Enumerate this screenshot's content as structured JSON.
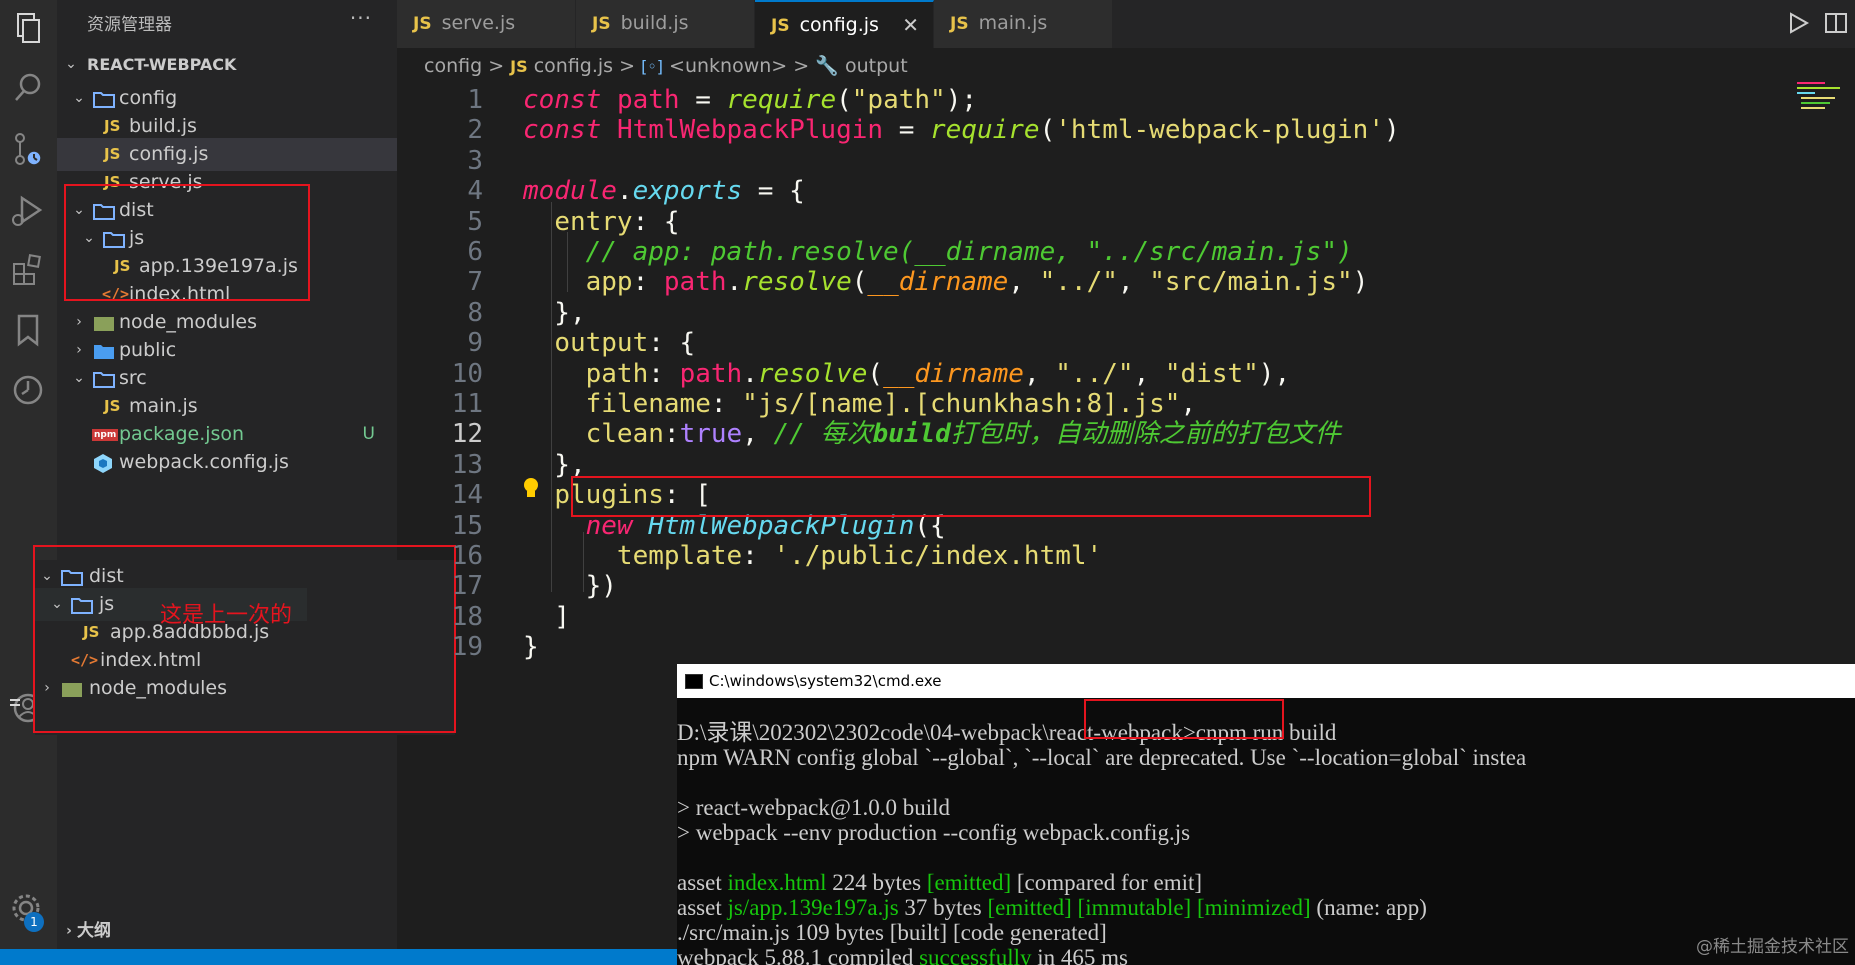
{
  "sidebar": {
    "title": "资源管理器",
    "more": "···",
    "root": "REACT-WEBPACK",
    "tree": [
      {
        "label": "config",
        "type": "folder",
        "open": true
      },
      {
        "label": "build.js",
        "type": "js"
      },
      {
        "label": "config.js",
        "type": "js",
        "selected": true
      },
      {
        "label": "serve.js",
        "type": "js"
      },
      {
        "label": "dist",
        "type": "folder",
        "open": true
      },
      {
        "label": "js",
        "type": "folder",
        "open": true
      },
      {
        "label": "app.139e197a.js",
        "type": "js"
      },
      {
        "label": "index.html",
        "type": "html"
      },
      {
        "label": "node_modules",
        "type": "folder-special",
        "open": false
      },
      {
        "label": "public",
        "type": "folder-blue",
        "open": false
      },
      {
        "label": "src",
        "type": "folder",
        "open": true
      },
      {
        "label": "main.js",
        "type": "js"
      },
      {
        "label": "package.json",
        "type": "npm",
        "git": "U"
      },
      {
        "label": "webpack.config.js",
        "type": "webpack"
      }
    ],
    "outline": "大纲",
    "npm_badge": "npm",
    "js_badge": "JS",
    "html_badge": "</>"
  },
  "previous_panel": {
    "annotation": "这是上一次的",
    "tree": [
      {
        "label": "dist"
      },
      {
        "label": "js"
      },
      {
        "label": "app.8addbbbd.js"
      },
      {
        "label": "index.html"
      },
      {
        "label": "node_modules"
      }
    ]
  },
  "tabs": [
    {
      "label": "serve.js",
      "icon": "JS"
    },
    {
      "label": "build.js",
      "icon": "JS"
    },
    {
      "label": "config.js",
      "icon": "JS",
      "active": true,
      "close": "✕"
    },
    {
      "label": "main.js",
      "icon": "JS"
    }
  ],
  "breadcrumb": {
    "folder": "config",
    "file_icon": "JS",
    "file": "config.js",
    "symbol_icon": "[◦]",
    "symbol": "<unknown>",
    "prop_icon": "🔧",
    "prop": "output",
    "sep": ">"
  },
  "code": {
    "line_numbers": [
      "1",
      "2",
      "3",
      "4",
      "5",
      "6",
      "7",
      "8",
      "9",
      "10",
      "11",
      "12",
      "13",
      "14",
      "15",
      "16",
      "17",
      "18",
      "19"
    ],
    "current_line": "12"
  },
  "cmd": {
    "title": "C:\\windows\\system32\\cmd.exe",
    "lines": {
      "l1": "D:\\录课\\202302\\2302code\\04-webpack\\react-webpack>cnpm run build",
      "l2": "npm WARN config global `--global`, `--local` are deprecated. Use `--location=global` instea",
      "l4": "> react-webpack@1.0.0 build",
      "l5": "> webpack --env production --config webpack.config.js",
      "l7a": "asset ",
      "l7b": "index.html",
      "l7c": " 224 bytes ",
      "l7d": "[emitted]",
      "l7e": " [compared for emit]",
      "l8a": "asset ",
      "l8b": "js/app.139e197a.js",
      "l8c": " 37 bytes ",
      "l8d": "[emitted] [immutable] [minimized]",
      "l8e": " (name: app)",
      "l9": "./src/main.js 109 bytes [built] [code generated]",
      "l10a": "webpack 5.88.1 compiled ",
      "l10b": "successfully",
      "l10c": " in 465 ms"
    }
  },
  "watermark": "@稀土掘金技术社区",
  "colors": {
    "red_box": "#e5141e",
    "accent": "#007acc",
    "js_yellow": "#e8c34a"
  }
}
